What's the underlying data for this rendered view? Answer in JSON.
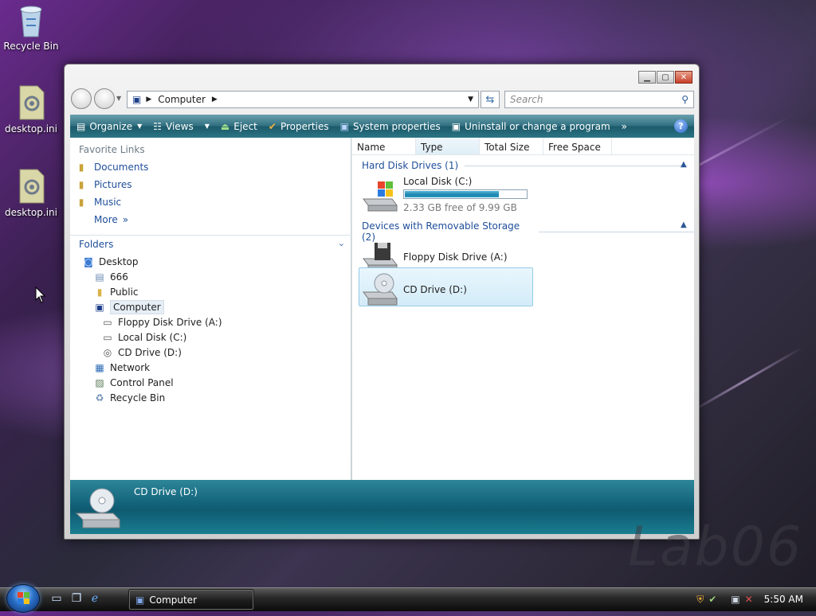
{
  "desktop": {
    "icons": [
      {
        "label": "Recycle Bin",
        "icon": "recycle-bin-icon"
      },
      {
        "label": "desktop.ini",
        "icon": "settings-file-icon"
      },
      {
        "label": "desktop.ini",
        "icon": "settings-file-icon"
      }
    ],
    "watermark": "Lab06"
  },
  "window": {
    "caption_buttons": [
      "minimize",
      "maximize",
      "close"
    ],
    "address": {
      "icon": "computer-icon",
      "path": "Computer"
    },
    "search_placeholder": "Search",
    "toolbar": {
      "organize": "Organize",
      "views": "Views",
      "eject": "Eject",
      "properties": "Properties",
      "system_properties": "System properties",
      "uninstall": "Uninstall or change a program",
      "more": "»"
    },
    "left": {
      "favorite_links_label": "Favorite Links",
      "favorites": [
        "Documents",
        "Pictures",
        "Music"
      ],
      "more_label": "More",
      "folders_label": "Folders",
      "tree": [
        {
          "label": "Desktop",
          "icon": "desktop-icon",
          "level": 0
        },
        {
          "label": "666",
          "icon": "user-folder-icon",
          "level": 1
        },
        {
          "label": "Public",
          "icon": "folder-icon",
          "level": 1
        },
        {
          "label": "Computer",
          "icon": "computer-icon",
          "level": 1,
          "selected": true
        },
        {
          "label": "Floppy Disk Drive (A:)",
          "icon": "floppy-drive-icon",
          "level": 2
        },
        {
          "label": "Local Disk (C:)",
          "icon": "hard-disk-icon",
          "level": 2
        },
        {
          "label": "CD Drive (D:)",
          "icon": "cd-drive-icon",
          "level": 2
        },
        {
          "label": "Network",
          "icon": "network-icon",
          "level": 1
        },
        {
          "label": "Control Panel",
          "icon": "control-panel-icon",
          "level": 1
        },
        {
          "label": "Recycle Bin",
          "icon": "recycle-bin-icon",
          "level": 1
        }
      ]
    },
    "right": {
      "columns": [
        "Name",
        "Type",
        "Total Size",
        "Free Space"
      ],
      "sorted_column": "Type",
      "groups": [
        {
          "label": "Hard Disk Drives (1)"
        },
        {
          "label": "Devices with Removable Storage (2)"
        }
      ],
      "local_disk": {
        "name": "Local Disk (C:)",
        "free_text": "2.33 GB free of 9.99 GB",
        "used_fraction": 0.767
      },
      "floppy": {
        "name": "Floppy Disk Drive (A:)"
      },
      "cd": {
        "name": "CD Drive (D:)",
        "selected": true
      }
    },
    "details": {
      "title": "CD Drive (D:)",
      "icon": "cd-drive-icon"
    }
  },
  "taskbar": {
    "task_button": "Computer",
    "clock": "5:50 AM",
    "tray_icons": [
      "security-shield-icon",
      "defender-icon",
      "network-disconnected-icon",
      "volume-muted-icon"
    ]
  },
  "colors": {
    "toolbar": "#1c5a6a",
    "details_pane": "#12627a",
    "link_blue": "#1e4e9a"
  }
}
